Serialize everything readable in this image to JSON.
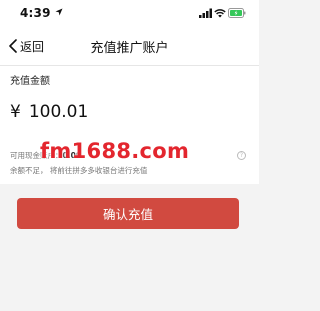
{
  "status_bar": {
    "time": "4:39",
    "icons": [
      "location-arrow-icon",
      "signal-icon",
      "wifi-icon",
      "battery-icon"
    ],
    "battery_color": "#35c759"
  },
  "nav": {
    "back_label": "返回",
    "title": "充值推广账户"
  },
  "recharge": {
    "amount_label": "充值金额",
    "currency_symbol": "¥",
    "amount_value": "100.01"
  },
  "info": {
    "balance_label": "可用现金账户：",
    "balance_value": "0.00",
    "hint": "余额不足，  将前往拼多多收银台进行充值",
    "help_symbol": "?"
  },
  "watermark": {
    "text": "fm1688.com",
    "color": "#e3262e"
  },
  "confirm_button": {
    "label": "确认充值",
    "color": "#d14a40"
  }
}
